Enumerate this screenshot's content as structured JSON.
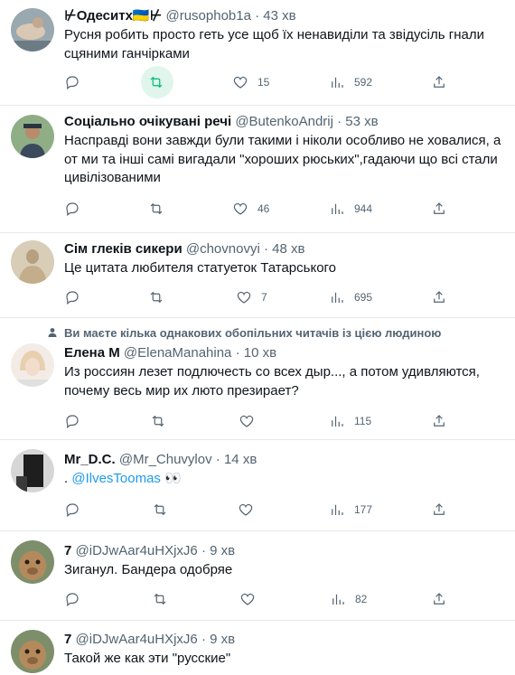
{
  "tweets": [
    {
      "name": "⊬Одеситх🇺🇦⊬",
      "handle": "@rusophob1a",
      "dot": "·",
      "time": "43 хв",
      "text": "Русня робить просто геть усе щоб їх ненавиділи та звідусіль гнали сцяними ганчірками",
      "likes": "15",
      "views": "592"
    },
    {
      "name": "Соціально очікувані речі",
      "handle": "@ButenkoAndrij",
      "dot": "·",
      "time": "53 хв",
      "text": "Насправді вони завжди були такими і ніколи особливо не ховалися, а от ми та інші самі вигадали \"хороших рюських\",гадаючи що всі стали цивілізованими",
      "likes": "46",
      "views": "944"
    },
    {
      "name": "Сім глеків сикери",
      "handle": "@chovnovyi",
      "dot": "·",
      "time": "48 хв",
      "text": "Це цитата любителя статуеток Татарського",
      "likes": "7",
      "views": "695"
    },
    {
      "notice": "Ви маєте кілька однакових обопільних читачів із цією людиною",
      "name": "Елена М",
      "handle": "@ElenaManahina",
      "dot": "·",
      "time": "10 хв",
      "text": "Из россиян лезет подлючесть со всех дыр..., а потом удивляются, почему весь мир их люто презирает?",
      "views": "115"
    },
    {
      "name": "Mr_D.C.",
      "handle": "@Mr_Chuvylov",
      "dot": "·",
      "time": "14 хв",
      "text_prefix": ". ",
      "mention": "@IlvesToomas",
      "emoji": " 👀",
      "views": "177"
    },
    {
      "name": "7",
      "handle": "@iDJwAar4uHXjxJ6",
      "dot": "·",
      "time": "9 хв",
      "text": "Зиганул. Бандера одобряе",
      "views": "82"
    },
    {
      "name": "7",
      "handle": "@iDJwAar4uHXjxJ6",
      "dot": "·",
      "time": "9 хв",
      "text": "Такой же как эти \"русские\""
    }
  ],
  "icons": {
    "reply": "reply-icon",
    "retweet": "retweet-icon",
    "like": "heart-icon",
    "views": "views-icon",
    "share": "share-icon"
  },
  "colors": {
    "text": "#0f1419",
    "secondary": "#536471",
    "link": "#1d9bf0",
    "retweet_active": "#00ba7c"
  }
}
